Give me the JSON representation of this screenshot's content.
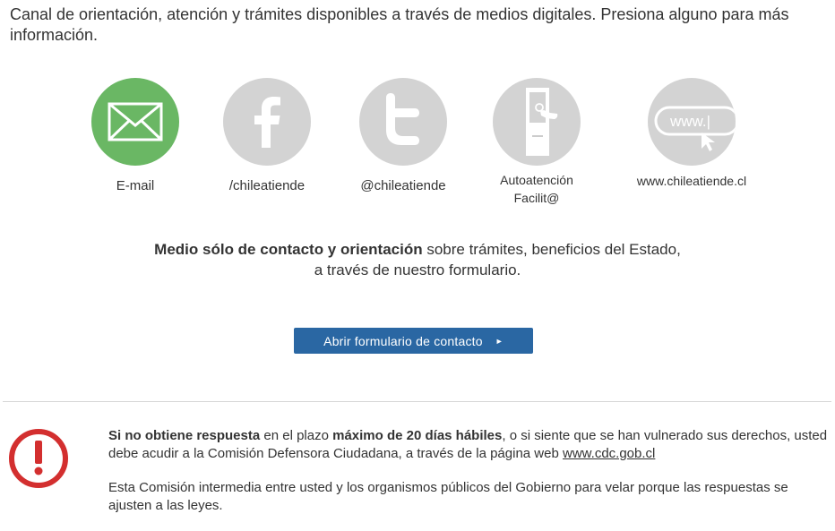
{
  "intro": "Canal de orientación, atención y trámites disponibles a través de medios digitales.  Presiona alguno para más información.",
  "channels": [
    {
      "label": "E-mail",
      "icon": "email-icon",
      "active": true
    },
    {
      "label": "/chileatiende",
      "icon": "facebook-icon",
      "active": false
    },
    {
      "label": "@chileatiende",
      "icon": "twitter-icon",
      "active": false
    },
    {
      "label_line1": "Autoatención",
      "label_line2": "Facilit@",
      "icon": "kiosk-icon",
      "active": false
    },
    {
      "label": "www.chileatiende.cl",
      "icon": "website-icon",
      "active": false
    }
  ],
  "website_icon_text": "www.|",
  "description": {
    "bold": "Medio sólo de contacto y orientación",
    "rest": " sobre trámites, beneficios del Estado,",
    "line2": "a través de nuestro formulario."
  },
  "cta": {
    "label": "Abrir formulario de contacto",
    "arrow": "►"
  },
  "notice": {
    "bold1": "Si no obtiene respuesta",
    "text1": " en el plazo ",
    "bold2": "máximo de 20 días hábiles",
    "text2": ", o si siente que se han vulnerado sus derechos, usted debe acudir a la Comisión Defensora Ciudadana, a través de la página web ",
    "link": "www.cdc.gob.cl",
    "paragraph2": "Esta Comisión intermedia entre usted y los organismos públicos del Gobierno para velar porque las respuestas se ajusten a las leyes."
  },
  "colors": {
    "active_circle": "#6ab764",
    "inactive_circle": "#d3d3d3",
    "button": "#2a67a3",
    "warning": "#d32f2f"
  }
}
